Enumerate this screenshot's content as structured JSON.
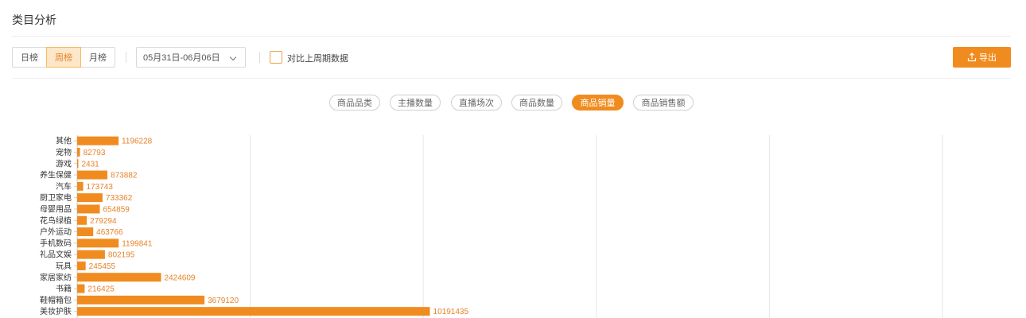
{
  "header": {
    "title": "类目分析"
  },
  "period_tabs": [
    {
      "label": "日榜",
      "active": false
    },
    {
      "label": "周榜",
      "active": true
    },
    {
      "label": "月榜",
      "active": false
    }
  ],
  "date_range": {
    "value": "05月31日-06月06日"
  },
  "compare": {
    "label": "对比上周期数据",
    "checked": false
  },
  "export": {
    "label": "导出"
  },
  "metric_tabs": [
    {
      "label": "商品品类",
      "active": false
    },
    {
      "label": "主播数量",
      "active": false
    },
    {
      "label": "直播场次",
      "active": false
    },
    {
      "label": "商品数量",
      "active": false
    },
    {
      "label": "商品销量",
      "active": true
    },
    {
      "label": "商品销售额",
      "active": false
    }
  ],
  "colors": {
    "accent": "#f08c1f",
    "bar": "#f08c1f",
    "value_text": "#e8822a"
  },
  "chart_data": {
    "type": "bar",
    "orientation": "horizontal",
    "categories": [
      "其他",
      "宠物",
      "游戏",
      "养生保健",
      "汽车",
      "厨卫家电",
      "母婴用品",
      "花鸟绿植",
      "户外运动",
      "手机数码",
      "礼品文娱",
      "玩具",
      "家居家纺",
      "书籍",
      "鞋帽箱包",
      "美妆护肤"
    ],
    "values": [
      1196228,
      82793,
      2431,
      873882,
      173743,
      733362,
      654859,
      279294,
      463766,
      1199841,
      802195,
      245455,
      2424609,
      216425,
      3679120,
      10191435
    ],
    "xlim": [
      0,
      25000000
    ],
    "grid": true,
    "title": "",
    "xlabel": "",
    "ylabel": ""
  }
}
